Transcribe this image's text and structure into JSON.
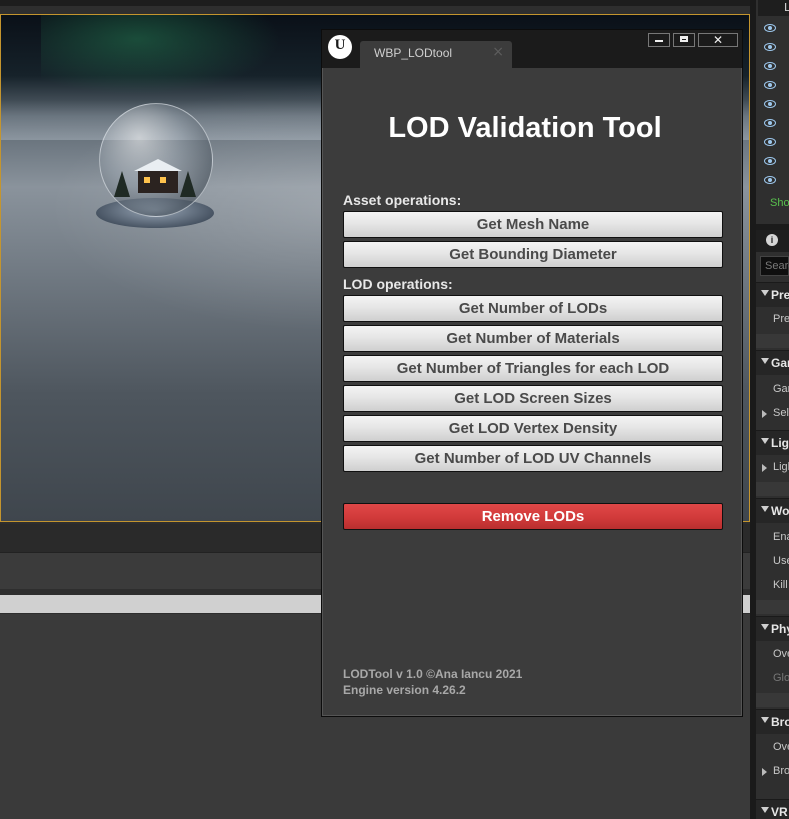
{
  "window": {
    "tab_title": "WBP_LODtool",
    "tab_close": "×",
    "close_glyph": "✕"
  },
  "tool": {
    "title": "LOD Validation Tool",
    "asset_section": "Asset operations:",
    "asset_buttons": [
      "Get Mesh Name",
      "Get Bounding Diameter"
    ],
    "lod_section": "LOD operations:",
    "lod_buttons": [
      "Get Number of LODs",
      "Get Number of Materials",
      "Get Number of Triangles for each LOD",
      "Get LOD Screen Sizes",
      "Get LOD Vertex Density",
      "Get Number of LOD UV Channels"
    ],
    "remove_button": "Remove LODs",
    "footer_line1": "LODTool v 1.0 ©Ana Iancu 2021",
    "footer_line2": "Engine version 4.26.2"
  },
  "right_panel": {
    "top_tab": "L",
    "show_link": "Sho",
    "search_placeholder": "Searc",
    "info_glyph": "i",
    "categories": [
      {
        "label": "Pre",
        "rows": [
          "Pre"
        ]
      },
      {
        "label": "Gar",
        "rows": [
          "Gar",
          "Sel"
        ]
      },
      {
        "label": "Ligh",
        "rows": [
          "Ligh"
        ]
      },
      {
        "label": "Wo",
        "rows": [
          "Ena",
          "Use",
          "Kill"
        ]
      },
      {
        "label": "Phy",
        "rows": [
          "Ove",
          "Glo"
        ]
      },
      {
        "label": "Bro",
        "rows": [
          "Ove",
          "Bro"
        ]
      },
      {
        "label": "VR",
        "rows": []
      }
    ]
  },
  "colors": {
    "accent_border": "#c4952e",
    "danger": "#d13a3a",
    "eye_icon": "#9dc8ee",
    "show_link": "#58c04d"
  }
}
